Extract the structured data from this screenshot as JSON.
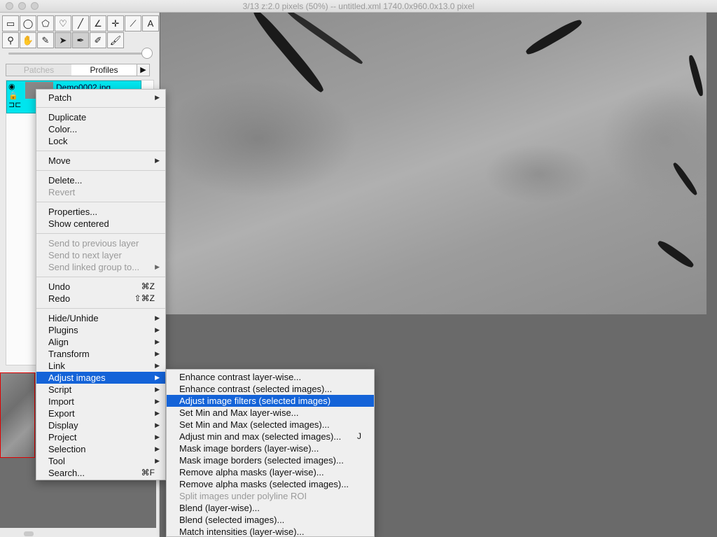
{
  "window": {
    "title": "3/13  z:2.0 pixels   (50%) -- untitled.xml  1740.0x960.0x13.0 pixel"
  },
  "toolbar": {
    "row1": [
      {
        "name": "rectangle-select-icon",
        "glyph": "▭"
      },
      {
        "name": "oval-select-icon",
        "glyph": "◯"
      },
      {
        "name": "polygon-select-icon",
        "glyph": "⬠"
      },
      {
        "name": "freehand-select-icon",
        "glyph": "♡"
      },
      {
        "name": "line-tool-icon",
        "glyph": "╱"
      },
      {
        "name": "angle-tool-icon",
        "glyph": "∠"
      },
      {
        "name": "point-tool-icon",
        "glyph": "✛"
      },
      {
        "name": "wand-tool-icon",
        "glyph": "⟋"
      },
      {
        "name": "text-tool-icon",
        "glyph": "A"
      }
    ],
    "row2": [
      {
        "name": "magnifier-icon",
        "glyph": "⚲"
      },
      {
        "name": "hand-tool-icon",
        "glyph": "✋"
      },
      {
        "name": "color-picker-icon",
        "glyph": "✎"
      },
      {
        "name": "arrow-tool-icon",
        "glyph": "➤"
      },
      {
        "name": "pen-tool-icon",
        "glyph": "✒"
      },
      {
        "name": "pencil-tool-icon",
        "glyph": "✐"
      },
      {
        "name": "brush-tool-icon",
        "glyph": "🖌"
      }
    ]
  },
  "tabs": {
    "patches": "Patches",
    "profiles": "Profiles",
    "more": "▶"
  },
  "layer": {
    "name": "Demo0002.jpg"
  },
  "context_menu": {
    "items": [
      {
        "label": "Patch",
        "submenu": true
      },
      {
        "separator": true
      },
      {
        "label": "Duplicate"
      },
      {
        "label": "Color..."
      },
      {
        "label": "Lock"
      },
      {
        "separator": true
      },
      {
        "label": "Move",
        "submenu": true
      },
      {
        "separator": true
      },
      {
        "label": "Delete..."
      },
      {
        "label": "Revert",
        "disabled": true
      },
      {
        "separator": true
      },
      {
        "label": "Properties..."
      },
      {
        "label": "Show centered"
      },
      {
        "separator": true
      },
      {
        "label": "Send to previous layer",
        "disabled": true
      },
      {
        "label": "Send to next layer",
        "disabled": true
      },
      {
        "label": "Send linked group to...",
        "disabled": true,
        "submenu": true
      },
      {
        "separator": true
      },
      {
        "label": "Undo",
        "shortcut": "⌘Z"
      },
      {
        "label": "Redo",
        "shortcut": "⇧⌘Z"
      },
      {
        "separator": true
      },
      {
        "label": "Hide/Unhide",
        "submenu": true
      },
      {
        "label": "Plugins",
        "submenu": true
      },
      {
        "label": "Align",
        "submenu": true
      },
      {
        "label": "Transform",
        "submenu": true
      },
      {
        "label": "Link",
        "submenu": true
      },
      {
        "label": "Adjust images",
        "submenu": true,
        "highlighted": true
      },
      {
        "label": "Script",
        "submenu": true
      },
      {
        "label": "Import",
        "submenu": true
      },
      {
        "label": "Export",
        "submenu": true
      },
      {
        "label": "Display",
        "submenu": true
      },
      {
        "label": "Project",
        "submenu": true
      },
      {
        "label": "Selection",
        "submenu": true
      },
      {
        "label": "Tool",
        "submenu": true
      },
      {
        "label": "Search...",
        "shortcut": "⌘F"
      }
    ]
  },
  "submenu": {
    "items": [
      {
        "label": "Enhance contrast layer-wise..."
      },
      {
        "label": "Enhance contrast (selected images)..."
      },
      {
        "label": "Adjust image filters (selected images)",
        "highlighted": true
      },
      {
        "label": "Set Min and Max layer-wise..."
      },
      {
        "label": "Set Min and Max (selected images)..."
      },
      {
        "label": "Adjust min and max (selected images)...",
        "shortcut": "J"
      },
      {
        "label": "Mask image borders (layer-wise)..."
      },
      {
        "label": "Mask image borders (selected images)..."
      },
      {
        "label": "Remove alpha masks (layer-wise)..."
      },
      {
        "label": "Remove alpha masks (selected images)..."
      },
      {
        "label": "Split images under polyline ROI",
        "disabled": true
      },
      {
        "label": "Blend (layer-wise)..."
      },
      {
        "label": "Blend (selected images)..."
      },
      {
        "label": "Match intensities (layer-wise)..."
      }
    ]
  },
  "colors": {
    "highlight": "#1463d8",
    "layer_selected": "#00e5ee",
    "minimap_frame": "#e00000"
  }
}
